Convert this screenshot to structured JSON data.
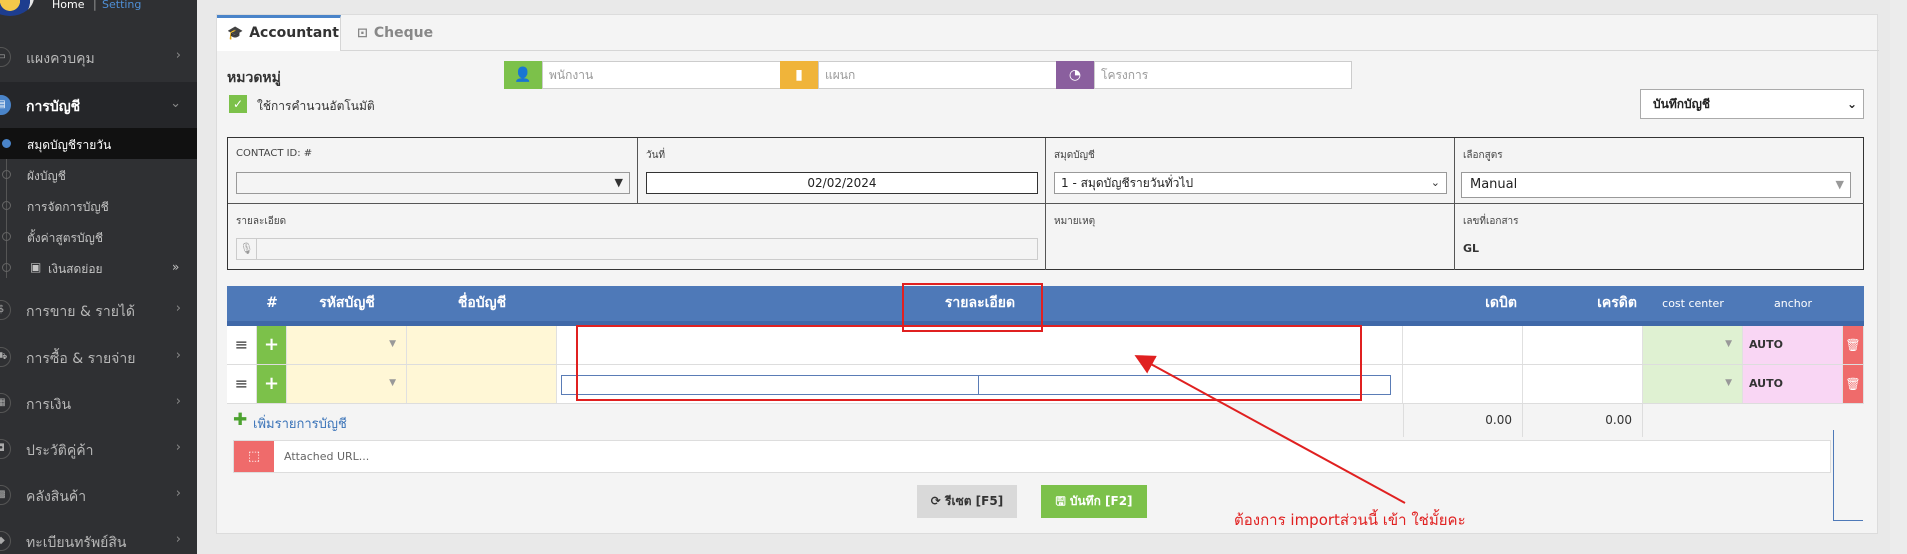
{
  "breadcrumb": {
    "home": "Home",
    "separator": "|",
    "setting": "Setting"
  },
  "sidebar": {
    "items": [
      {
        "label": "แผงควบคุม",
        "icon": "monitor-icon"
      },
      {
        "label": "การบัญชี",
        "icon": "book-icon",
        "active": true
      },
      {
        "label": "การขาย & รายได้",
        "icon": "dollar-icon"
      },
      {
        "label": "การซื้อ & รายจ่าย",
        "icon": "cart-icon"
      },
      {
        "label": "การเงิน",
        "icon": "calendar-icon"
      },
      {
        "label": "ประวัติคู่ค้า",
        "icon": "contact-icon"
      },
      {
        "label": "คลังสินค้า",
        "icon": "boxes-icon"
      },
      {
        "label": "ทะเบียนทรัพย์สิน",
        "icon": "diamond-icon"
      }
    ],
    "sub_items": [
      {
        "label": "สมุดบัญชีรายวัน",
        "active": true
      },
      {
        "label": "ผังบัญชี"
      },
      {
        "label": "การจัดการบัญชี"
      },
      {
        "label": "ตั้งค่าสูตรบัญชี"
      },
      {
        "label": "เงินสดย่อย"
      }
    ]
  },
  "tabs": [
    {
      "label": "Accountant",
      "icon": "graduation-cap-icon",
      "active": true
    },
    {
      "label": "Cheque",
      "icon": "money-icon"
    }
  ],
  "form": {
    "category_label": "หมวดหมู่",
    "auto_calc_label": "ใช้การคำนวนอัตโนมัติ",
    "auto_calc_checked": true,
    "employee_placeholder": "พนักงาน",
    "department_placeholder": "แผนก",
    "project_placeholder": "โครงการ",
    "journal_type": "บันทึกบัญชี",
    "contact_label": "CONTACT ID: #",
    "contact_value": "",
    "date_label": "วันที่",
    "date_value": "02/02/2024",
    "book_label": "สมุดบัญชี",
    "book_value": "1 - สมุดบัญชีรายวันทั่วไป",
    "formula_label": "เลือกสูตร",
    "formula_value": "Manual",
    "detail_label": "รายละเอียด",
    "detail_value": "",
    "note_label": "หมายเหตุ",
    "docno_label": "เลขที่เอกสาร",
    "docno_value": "GL"
  },
  "table": {
    "columns": [
      "#",
      "รหัสบัญชี",
      "ชื่อบัญชี",
      "รายละเอียด",
      "เดบิต",
      "เครดิต",
      "cost center",
      "anchor"
    ],
    "rows": [
      {
        "anchor": "AUTO"
      },
      {
        "anchor": "AUTO"
      }
    ],
    "add_line_label": "เพิ่มรายการบัญชี",
    "total_debit": "0.00",
    "total_credit": "0.00",
    "attach_placeholder": "Attached URL..."
  },
  "buttons": {
    "reset": "รีเซต [F5]",
    "save": "บันทึก [F2]"
  },
  "annotation": {
    "text": "ต้องการ  importส่วนนี้  เข้า ใช่มั้ยคะ",
    "color": "#e02020"
  },
  "colors": {
    "accent": "#4e79b8",
    "green": "#7cc14a",
    "red": "#ef6b6b",
    "sidebar": "#2f3033"
  }
}
